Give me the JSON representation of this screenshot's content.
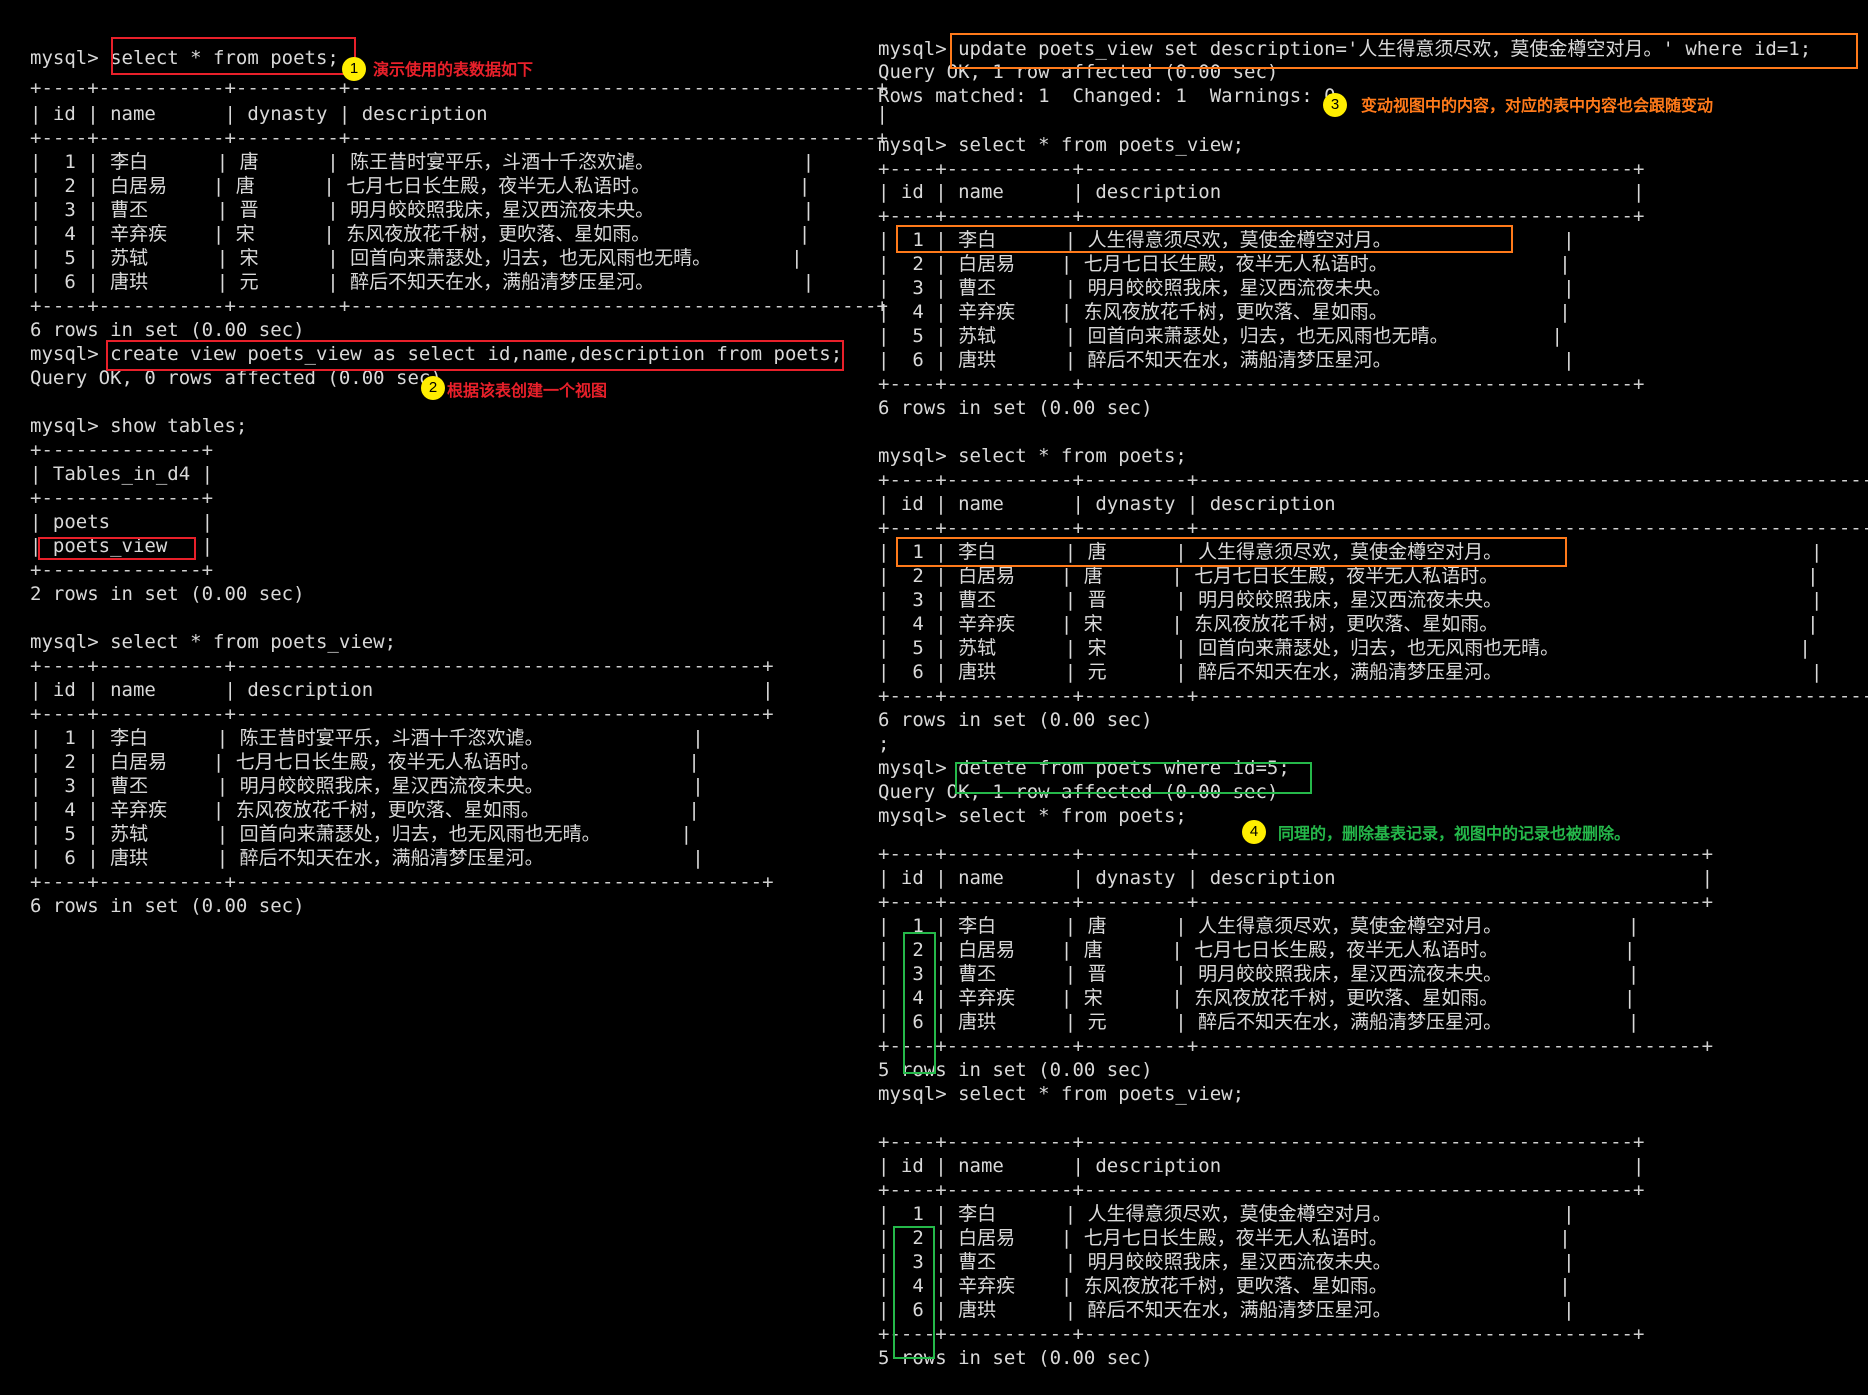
{
  "colors": {
    "background": "#000000",
    "text": "#d9d9d9",
    "red_annotation": "#e8202a",
    "orange_annotation": "#ff7a1a",
    "green_annotation": "#25b84a",
    "badge": "#ffee00"
  },
  "left": {
    "lines": [
      "mysql> select * from poets;",
      "+----+-----------+---------+----------------------------------------------+",
      "| id | name      | dynasty | description                                  |",
      "+----+-----------+---------+----------------------------------------------+",
      "|  1 | 李白      | 唐      | 陈王昔时宴平乐，斗酒十千恣欢谑。             |",
      "|  2 | 白居易    | 唐      | 七月七日长生殿，夜半无人私语时。             |",
      "|  3 | 曹丕      | 晋      | 明月皎皎照我床，星汉西流夜未央。             |",
      "|  4 | 辛弃疾    | 宋      | 东风夜放花千树，更吹落、星如雨。             |",
      "|  5 | 苏轼      | 宋      | 回首向来萧瑟处，归去，也无风雨也无晴。       |",
      "|  6 | 唐珙      | 元      | 醉后不知天在水，满船清梦压星河。             |",
      "+----+-----------+---------+----------------------------------------------+",
      "6 rows in set (0.00 sec)",
      "mysql> create view poets_view as select id,name,description from poets;",
      "Query OK, 0 rows affected (0.00 sec)",
      "mysql> show tables;",
      "+--------------+",
      "| Tables_in_d4 |",
      "+--------------+",
      "| poets        |",
      "| poets_view   |",
      "+--------------+",
      "2 rows in set (0.00 sec)",
      "mysql> select * from poets_view;",
      "+----+-----------+----------------------------------------------+",
      "| id | name      | description                                  |",
      "+----+-----------+----------------------------------------------+",
      "|  1 | 李白      | 陈王昔时宴平乐，斗酒十千恣欢谑。             |",
      "|  2 | 白居易    | 七月七日长生殿，夜半无人私语时。             |",
      "|  3 | 曹丕      | 明月皎皎照我床，星汉西流夜未央。             |",
      "|  4 | 辛弃疾    | 东风夜放花千树，更吹落、星如雨。             |",
      "|  5 | 苏轼      | 回首向来萧瑟处，归去，也无风雨也无晴。       |",
      "|  6 | 唐珙      | 醉后不知天在水，满船清梦压星河。             |",
      "+----+-----------+----------------------------------------------+",
      "6 rows in set (0.00 sec)"
    ]
  },
  "right": {
    "lines": [
      "mysql> update poets_view set description='人生得意须尽欢，莫使金樽空对月。' where id=1;",
      "Query OK, 1 row affected (0.00 sec)",
      "Rows matched: 1  Changed: 1  Warnings: 0",
      "mysql> select * from poets_view;",
      "+----+-----------+------------------------------------------------+",
      "| id | name      | description                                    |",
      "+----+-----------+------------------------------------------------+",
      "|  1 | 李白      | 人生得意须尽欢，莫使金樽空对月。               |",
      "|  2 | 白居易    | 七月七日长生殿，夜半无人私语时。               |",
      "|  3 | 曹丕      | 明月皎皎照我床，星汉西流夜未央。               |",
      "|  4 | 辛弃疾    | 东风夜放花千树，更吹落、星如雨。               |",
      "|  5 | 苏轼      | 回首向来萧瑟处，归去，也无风雨也无晴。         |",
      "|  6 | 唐珙      | 醉后不知天在水，满船清梦压星河。               |",
      "+----+-----------+------------------------------------------------+",
      "6 rows in set (0.00 sec)",
      "mysql> select * from poets;",
      "+----+-----------+---------+------------------------------------------------------------+",
      "| id | name      | dynasty | description                                                |",
      "+----+-----------+---------+------------------------------------------------------------+",
      "|  1 | 李白      | 唐      | 人生得意须尽欢，莫使金樽空对月。                           |",
      "|  2 | 白居易    | 唐      | 七月七日长生殿，夜半无人私语时。                           |",
      "|  3 | 曹丕      | 晋      | 明月皎皎照我床，星汉西流夜未央。                           |",
      "|  4 | 辛弃疾    | 宋      | 东风夜放花千树，更吹落、星如雨。                           |",
      "|  5 | 苏轼      | 宋      | 回首向来萧瑟处，归去，也无风雨也无晴。                     |",
      "|  6 | 唐珙      | 元      | 醉后不知天在水，满船清梦压星河。                           |",
      "+----+-----------+---------+------------------------------------------------------------+",
      "6 rows in set (0.00 sec)",
      ";",
      "mysql> delete from poets where id=5;",
      "Query OK, 1 row affected (0.00 sec)",
      "mysql> select * from poets;",
      "+----+-----------+---------+--------------------------------------------+",
      "| id | name      | dynasty | description                                |",
      "+----+-----------+---------+--------------------------------------------+",
      "|  1 | 李白      | 唐      | 人生得意须尽欢，莫使金樽空对月。           |",
      "|  2 | 白居易    | 唐      | 七月七日长生殿，夜半无人私语时。           |",
      "|  3 | 曹丕      | 晋      | 明月皎皎照我床，星汉西流夜未央。           |",
      "|  4 | 辛弃疾    | 宋      | 东风夜放花千树，更吹落、星如雨。           |",
      "|  6 | 唐珙      | 元      | 醉后不知天在水，满船清梦压星河。           |",
      "+----+-----------+---------+--------------------------------------------+",
      "5 rows in set (0.00 sec)",
      "mysql> select * from poets_view;",
      "+----+-----------+------------------------------------------------+",
      "| id | name      | description                                    |",
      "+----+-----------+------------------------------------------------+",
      "|  1 | 李白      | 人生得意须尽欢，莫使金樽空对月。               |",
      "|  2 | 白居易    | 七月七日长生殿，夜半无人私语时。               |",
      "|  3 | 曹丕      | 明月皎皎照我床，星汉西流夜未央。               |",
      "|  4 | 辛弃疾    | 东风夜放花千树，更吹落、星如雨。               |",
      "|  6 | 唐珙      | 醉后不知天在水，满船清梦压星河。               |",
      "+----+-----------+------------------------------------------------+",
      "5 rows in set (0.00 sec)"
    ]
  },
  "annotations": [
    {
      "number": "1",
      "text": "演示使用的表数据如下"
    },
    {
      "number": "2",
      "text": "根据该表创建一个视图"
    },
    {
      "number": "3",
      "text": "变动视图中的内容，对应的表中内容也会跟随变动"
    },
    {
      "number": "4",
      "text": "同理的，删除基表记录，视图中的记录也被删除。"
    }
  ]
}
